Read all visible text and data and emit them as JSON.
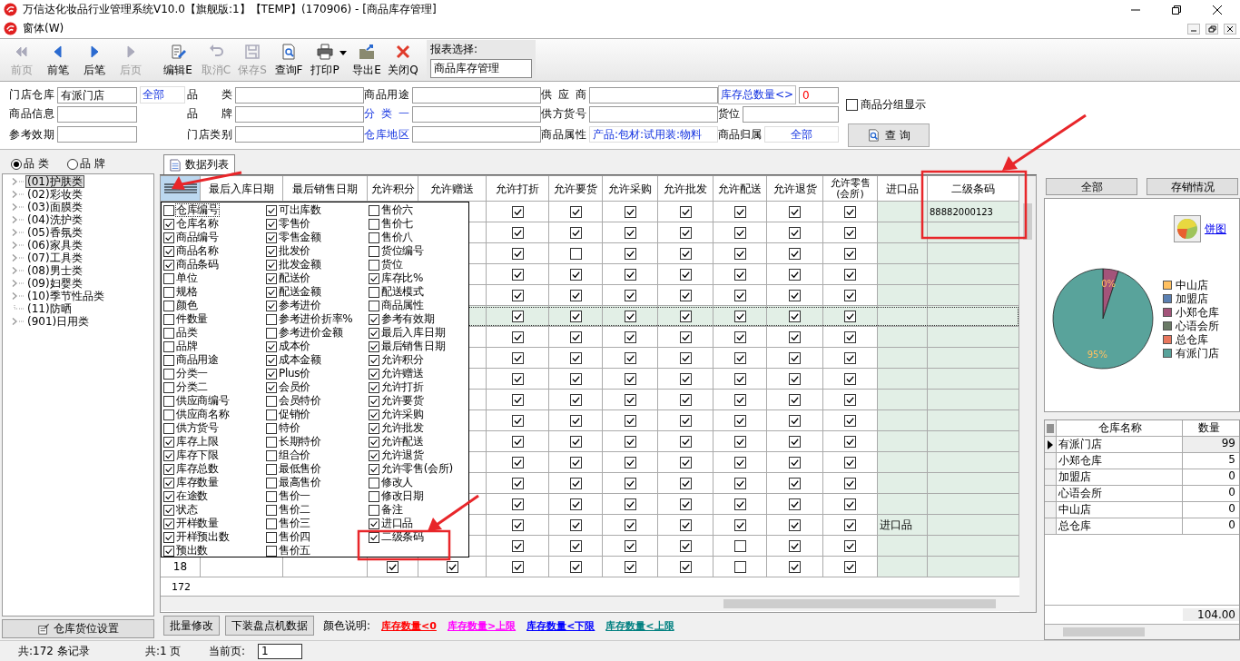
{
  "window": {
    "title": "万信达化妆品行业管理系统V10.0【旗舰版:1】【TEMP】(170906) - [商品库存管理]"
  },
  "menu": {
    "label": "窗体(W)"
  },
  "toolbar": [
    {
      "label": "前页",
      "disabled": true
    },
    {
      "label": "前笔",
      "disabled": false
    },
    {
      "label": "后笔",
      "disabled": false
    },
    {
      "label": "后页",
      "disabled": true
    },
    {
      "label": "编辑E",
      "disabled": false
    },
    {
      "label": "取消C",
      "disabled": true
    },
    {
      "label": "保存S",
      "disabled": true
    },
    {
      "label": "查询F",
      "disabled": false
    },
    {
      "label": "打印P",
      "disabled": false,
      "dropdown": true
    },
    {
      "label": "导出E",
      "disabled": false
    },
    {
      "label": "关闭Q",
      "disabled": false
    }
  ],
  "report_select": {
    "label": "报表选择:",
    "value": "商品库存管理"
  },
  "filters": [
    [
      {
        "label": "门店仓库",
        "link": false,
        "value": "有派门店",
        "extra": "全部"
      },
      {
        "label": "品 类",
        "link": false
      },
      {
        "label": "商品用途",
        "link": false
      },
      {
        "label": "供 应 商",
        "link": false
      },
      {
        "label": "库存总数量<>",
        "link": true,
        "value": "0",
        "kind": "alert"
      }
    ],
    [
      {
        "label": "商品信息",
        "link": false
      },
      {
        "label": "品 牌",
        "link": false
      },
      {
        "label": "分 类 一",
        "link": true
      },
      {
        "label": "供方货号",
        "link": false
      },
      {
        "label": "货位",
        "link": false
      }
    ],
    [
      {
        "label": "参考效期",
        "link": false
      },
      {
        "label": "门店类别",
        "link": false
      },
      {
        "label": "仓库地区",
        "link": true
      },
      {
        "label": "商品属性",
        "link": false,
        "value": "产品:包材:试用装:物料",
        "kind": "link"
      },
      {
        "label": "商品归属",
        "link": false,
        "value": "全部",
        "kind": "link"
      }
    ]
  ],
  "group_display": {
    "label": "商品分组显示",
    "checked": false
  },
  "query_button": "查 询",
  "sidebar": {
    "radios": [
      {
        "label": "品 类",
        "selected": true
      },
      {
        "label": "品 牌",
        "selected": false
      }
    ],
    "tree": [
      {
        "label": "(01)护肤类",
        "expandable": true,
        "selected": true
      },
      {
        "label": "(02)彩妆类",
        "expandable": true,
        "selected": false
      },
      {
        "label": "(03)面膜类",
        "expandable": true,
        "selected": false
      },
      {
        "label": "(04)洗护类",
        "expandable": true,
        "selected": false
      },
      {
        "label": "(05)香氛类",
        "expandable": true,
        "selected": false
      },
      {
        "label": "(06)家具类",
        "expandable": true,
        "selected": false
      },
      {
        "label": "(07)工具类",
        "expandable": true,
        "selected": false
      },
      {
        "label": "(08)男士类",
        "expandable": true,
        "selected": false
      },
      {
        "label": "(09)妇婴类",
        "expandable": true,
        "selected": false
      },
      {
        "label": "(10)季节性品类",
        "expandable": true,
        "selected": false
      },
      {
        "label": "(11)防晒",
        "expandable": false,
        "selected": false
      },
      {
        "label": "(901)日用类",
        "expandable": true,
        "selected": false
      }
    ],
    "button": "仓库货位设置"
  },
  "tabs": [
    {
      "label": "数据列表",
      "selected": true
    }
  ],
  "grid": {
    "columns": [
      "最后入库日期",
      "最后销售日期",
      "允许积分",
      "允许赠送",
      "允许打折",
      "允许要货",
      "允许采购",
      "允许批发",
      "允许配送",
      "允许退货",
      "允许零售(会所)",
      "进口品",
      "二级条码"
    ],
    "rows": [
      {
        "selected": false,
        "checks": [
          true,
          true,
          true,
          true,
          true,
          true,
          true
        ],
        "barcode": "88882000123"
      },
      {
        "selected": false,
        "checks": [
          true,
          true,
          true,
          true,
          true,
          true,
          true
        ]
      },
      {
        "selected": false,
        "checks": [
          true,
          false,
          true,
          true,
          true,
          true,
          true
        ]
      },
      {
        "selected": false,
        "checks": [
          true,
          true,
          true,
          true,
          true,
          true,
          true
        ]
      },
      {
        "selected": false,
        "checks": [
          true,
          true,
          true,
          true,
          true,
          true,
          true
        ]
      },
      {
        "selected": true,
        "checks": [
          true,
          true,
          true,
          true,
          true,
          true,
          true
        ]
      },
      {
        "selected": false,
        "checks": [
          true,
          true,
          true,
          true,
          true,
          true,
          true
        ]
      },
      {
        "selected": false,
        "checks": [
          true,
          true,
          true,
          true,
          true,
          true,
          true
        ]
      },
      {
        "selected": false,
        "checks": [
          true,
          true,
          true,
          true,
          true,
          true,
          true
        ]
      },
      {
        "selected": false,
        "checks": [
          true,
          true,
          true,
          true,
          true,
          true,
          true
        ]
      },
      {
        "selected": false,
        "checks": [
          true,
          true,
          true,
          true,
          true,
          true,
          true
        ]
      },
      {
        "selected": false,
        "checks": [
          true,
          true,
          true,
          true,
          true,
          true,
          true
        ]
      },
      {
        "selected": false,
        "checks": [
          true,
          true,
          true,
          true,
          true,
          true,
          true
        ]
      },
      {
        "selected": false,
        "checks": [
          true,
          true,
          true,
          true,
          true,
          true,
          true
        ]
      },
      {
        "selected": false,
        "checks": [
          true,
          true,
          true,
          true,
          true,
          true,
          true
        ]
      },
      {
        "selected": false,
        "checks": [
          true,
          true,
          true,
          true,
          true,
          true,
          true
        ],
        "import_item": "进口品"
      },
      {
        "selected": false,
        "checks": [
          true,
          true,
          true,
          true,
          false,
          true,
          true
        ]
      },
      {
        "selected": false,
        "row_number": "18",
        "points": true,
        "gift": true,
        "checks": [
          true,
          true,
          true,
          true,
          false,
          true,
          true
        ]
      }
    ],
    "footer": "172"
  },
  "column_chooser": [
    [
      {
        "label": "仓库编号",
        "checked": false
      },
      {
        "label": "仓库名称",
        "checked": true
      },
      {
        "label": "商品编号",
        "checked": true
      },
      {
        "label": "商品名称",
        "checked": true
      },
      {
        "label": "商品条码",
        "checked": true
      },
      {
        "label": "单位",
        "checked": false
      },
      {
        "label": "规格",
        "checked": false
      },
      {
        "label": "颜色",
        "checked": false
      },
      {
        "label": "件数量",
        "checked": false
      },
      {
        "label": "品类",
        "checked": false
      },
      {
        "label": "品牌",
        "checked": false
      },
      {
        "label": "商品用途",
        "checked": false
      },
      {
        "label": "分类一",
        "checked": false
      },
      {
        "label": "分类二",
        "checked": false
      },
      {
        "label": "供应商编号",
        "checked": false
      },
      {
        "label": "供应商名称",
        "checked": false
      },
      {
        "label": "供方货号",
        "checked": false
      },
      {
        "label": "库存上限",
        "checked": true
      },
      {
        "label": "库存下限",
        "checked": true
      },
      {
        "label": "库存总数",
        "checked": true
      },
      {
        "label": "库存数量",
        "checked": true
      },
      {
        "label": "在途数",
        "checked": true
      },
      {
        "label": "状态",
        "checked": true
      },
      {
        "label": "开样数量",
        "checked": true
      },
      {
        "label": "开样预出数",
        "checked": true
      },
      {
        "label": "预出数",
        "checked": true
      }
    ],
    [
      {
        "label": "可出库数",
        "checked": true
      },
      {
        "label": "零售价",
        "checked": true
      },
      {
        "label": "零售金额",
        "checked": true
      },
      {
        "label": "批发价",
        "checked": true
      },
      {
        "label": "批发金额",
        "checked": true
      },
      {
        "label": "配送价",
        "checked": true
      },
      {
        "label": "配送金额",
        "checked": true
      },
      {
        "label": "参考进价",
        "checked": true
      },
      {
        "label": "参考进价折率%",
        "checked": false
      },
      {
        "label": "参考进价金额",
        "checked": false
      },
      {
        "label": "成本价",
        "checked": true
      },
      {
        "label": "成本金额",
        "checked": true
      },
      {
        "label": "Plus价",
        "checked": true
      },
      {
        "label": "会员价",
        "checked": true
      },
      {
        "label": "会员特价",
        "checked": false
      },
      {
        "label": "促销价",
        "checked": false
      },
      {
        "label": "特价",
        "checked": false
      },
      {
        "label": "长期特价",
        "checked": false
      },
      {
        "label": "组合价",
        "checked": false
      },
      {
        "label": "最低售价",
        "checked": false
      },
      {
        "label": "最高售价",
        "checked": false
      },
      {
        "label": "售价一",
        "checked": false
      },
      {
        "label": "售价二",
        "checked": false
      },
      {
        "label": "售价三",
        "checked": false
      },
      {
        "label": "售价四",
        "checked": false
      },
      {
        "label": "售价五",
        "checked": false
      }
    ],
    [
      {
        "label": "售价六",
        "checked": false
      },
      {
        "label": "售价七",
        "checked": false
      },
      {
        "label": "售价八",
        "checked": false
      },
      {
        "label": "货位编号",
        "checked": false
      },
      {
        "label": "货位",
        "checked": false
      },
      {
        "label": "库存比%",
        "checked": true
      },
      {
        "label": "配送模式",
        "checked": false
      },
      {
        "label": "商品属性",
        "checked": false
      },
      {
        "label": "参考有效期",
        "checked": true
      },
      {
        "label": "最后入库日期",
        "checked": true
      },
      {
        "label": "最后销售日期",
        "checked": true
      },
      {
        "label": "允许积分",
        "checked": true
      },
      {
        "label": "允许赠送",
        "checked": true
      },
      {
        "label": "允许打折",
        "checked": true
      },
      {
        "label": "允许要货",
        "checked": true
      },
      {
        "label": "允许采购",
        "checked": true
      },
      {
        "label": "允许批发",
        "checked": true
      },
      {
        "label": "允许配送",
        "checked": true
      },
      {
        "label": "允许退货",
        "checked": true
      },
      {
        "label": "允许零售(会所)",
        "checked": true
      },
      {
        "label": "修改人",
        "checked": false
      },
      {
        "label": "修改日期",
        "checked": false
      },
      {
        "label": "备注",
        "checked": false
      },
      {
        "label": "进口品",
        "checked": true
      },
      {
        "label": "二级条码",
        "checked": true
      }
    ]
  ],
  "bottom_buttons": [
    "批量修改",
    "下装盘点机数据"
  ],
  "color_legend": {
    "label": "颜色说明:",
    "items": [
      {
        "label": "库存数量<0",
        "color": "#ff0000"
      },
      {
        "label": "库存数量>上限",
        "color": "#ff00ff"
      },
      {
        "label": "库存数量<下限",
        "color": "#0000ff"
      },
      {
        "label": "库存数量<上限",
        "color": "#008080"
      }
    ]
  },
  "right_panel": {
    "buttons": [
      "全部",
      "存销情况"
    ],
    "chart_link": "饼图",
    "chart_data": {
      "type": "pie",
      "categories": [
        "中山店",
        "加盟店",
        "小郑仓库",
        "心语会所",
        "总仓库",
        "有派门店"
      ],
      "colors": [
        "#ffc060",
        "#5b80b2",
        "#a3547a",
        "#6a7a66",
        "#e8775e",
        "#59a39b"
      ],
      "legend": "right",
      "series": [
        {
          "values": [
            0,
            0,
            5,
            0,
            0,
            95
          ]
        }
      ],
      "value_labels": [
        null,
        null,
        "0%",
        null,
        null,
        "95%"
      ]
    },
    "table": {
      "columns": [
        "仓库名称",
        "数量"
      ],
      "rows": [
        {
          "name": "有派门店",
          "qty": "99",
          "selected": true
        },
        {
          "name": "小郑仓库",
          "qty": "5",
          "selected": false
        },
        {
          "name": "加盟店",
          "qty": "0",
          "selected": false
        },
        {
          "name": "心语会所",
          "qty": "0",
          "selected": false
        },
        {
          "name": "中山店",
          "qty": "0",
          "selected": false
        },
        {
          "name": "总仓库",
          "qty": "0",
          "selected": false
        }
      ],
      "total": "104.00"
    }
  },
  "status_bar": {
    "records": "共:172 条记录",
    "pages": "共:1 页",
    "current_label": "当前页:",
    "current": "1"
  }
}
